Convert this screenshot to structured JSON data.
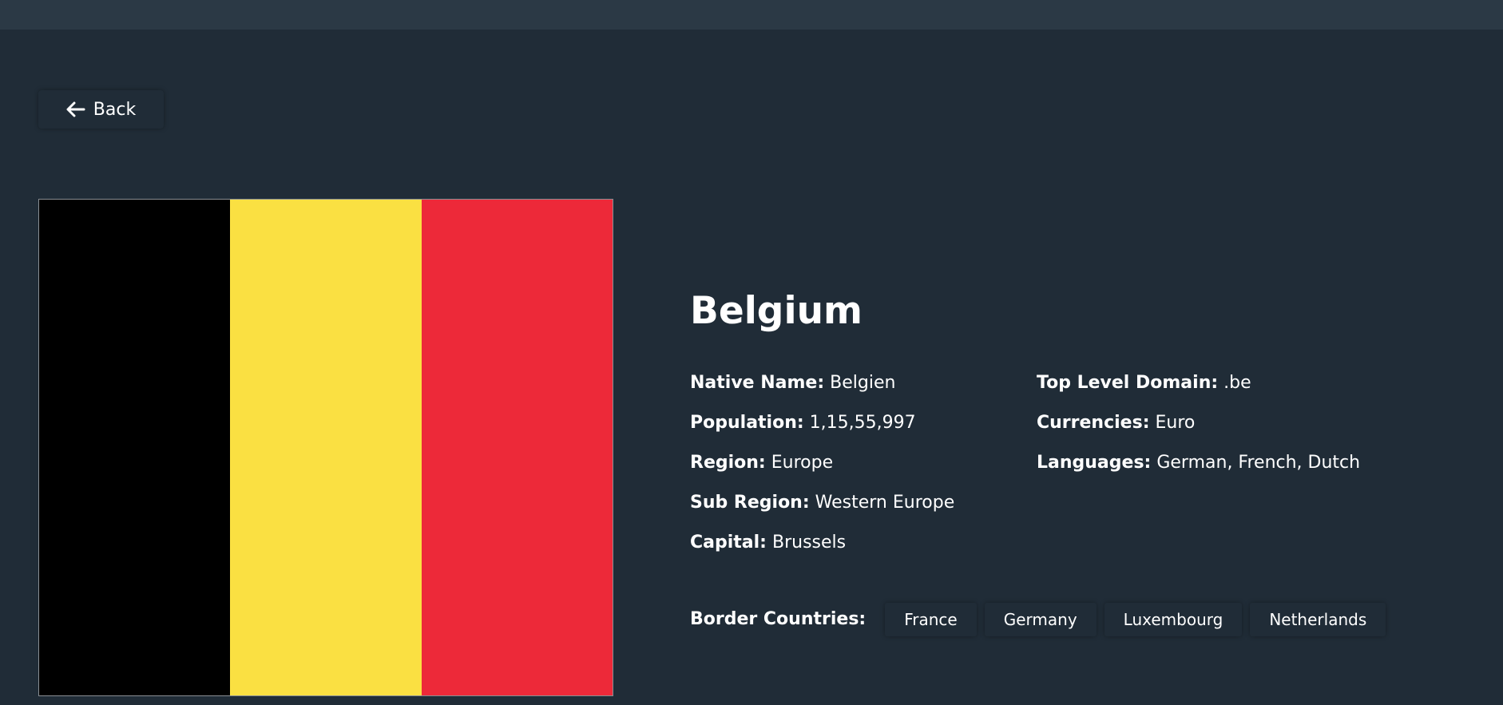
{
  "header": {},
  "back_button": {
    "label": "Back",
    "icon": "arrow-left-icon"
  },
  "flag": {
    "country": "Belgium",
    "colors": [
      "#000000",
      "#fae042",
      "#ed2939"
    ]
  },
  "country": {
    "name": "Belgium",
    "left_fields": [
      {
        "label": "Native Name:",
        "value": "Belgien"
      },
      {
        "label": "Population:",
        "value": "1,15,55,997"
      },
      {
        "label": "Region:",
        "value": "Europe"
      },
      {
        "label": "Sub Region:",
        "value": "Western Europe"
      },
      {
        "label": "Capital:",
        "value": "Brussels"
      }
    ],
    "right_fields": [
      {
        "label": "Top Level Domain:",
        "value": ".be"
      },
      {
        "label": "Currencies:",
        "value": "Euro"
      },
      {
        "label": "Languages:",
        "value": "German, French, Dutch"
      }
    ],
    "border_label": "Border Countries:",
    "border_countries": [
      "France",
      "Germany",
      "Luxembourg",
      "Netherlands"
    ]
  },
  "theme": {
    "background": "#202c37",
    "elements": "#2b3945",
    "text": "#ffffff"
  }
}
